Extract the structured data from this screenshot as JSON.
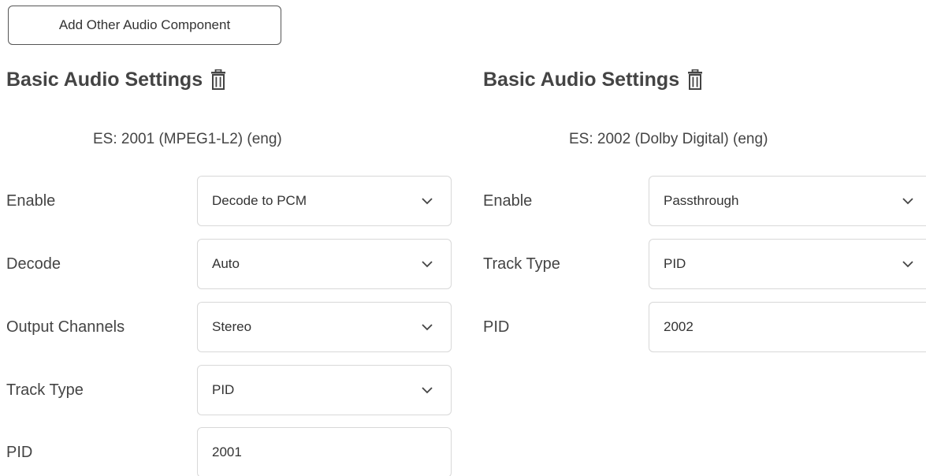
{
  "toolbar": {
    "add_label": "Add Other Audio Component"
  },
  "panels": [
    {
      "title": "Basic Audio Settings",
      "es": "ES: 2001 (MPEG1-L2) (eng)",
      "fields": {
        "enable": {
          "label": "Enable",
          "value": "Decode to PCM"
        },
        "decode": {
          "label": "Decode",
          "value": "Auto"
        },
        "output_channels": {
          "label": "Output Channels",
          "value": "Stereo"
        },
        "track_type": {
          "label": "Track Type",
          "value": "PID"
        },
        "pid": {
          "label": "PID",
          "value": "2001"
        }
      }
    },
    {
      "title": "Basic Audio Settings",
      "es": "ES: 2002 (Dolby Digital) (eng)",
      "fields": {
        "enable": {
          "label": "Enable",
          "value": "Passthrough"
        },
        "track_type": {
          "label": "Track Type",
          "value": "PID"
        },
        "pid": {
          "label": "PID",
          "value": "2002"
        }
      }
    }
  ],
  "icons": {
    "trash": "trash-icon",
    "chevron": "chevron-down-icon"
  },
  "colors": {
    "text": "#444444",
    "border": "#d8d8d8",
    "button_border": "#555555"
  }
}
